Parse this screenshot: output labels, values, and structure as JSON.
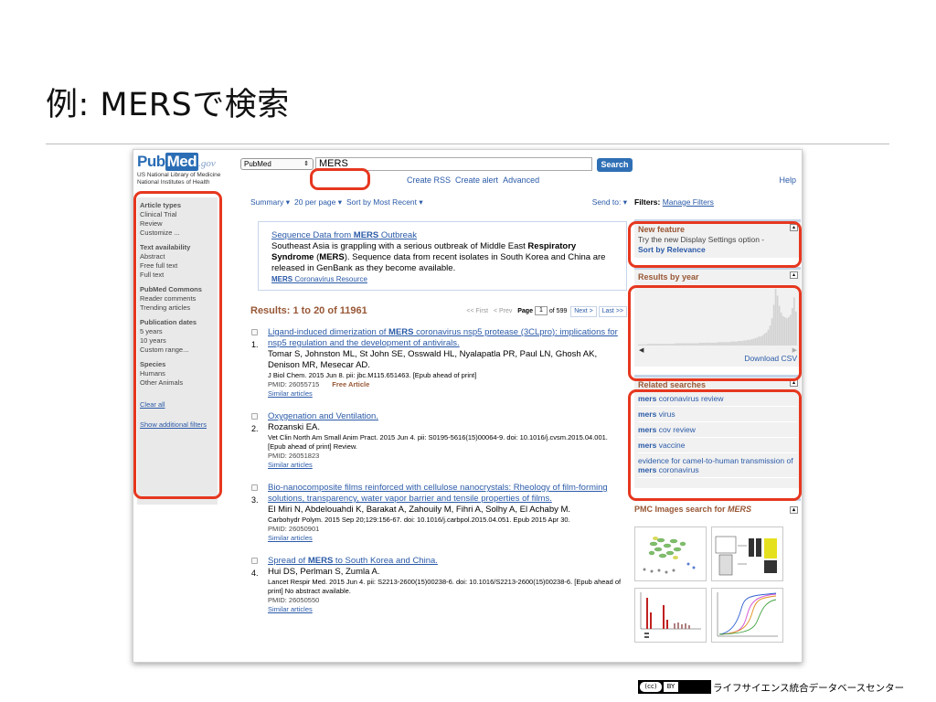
{
  "slide": {
    "title": "例: MERSで検索",
    "footer": "ライフサイエンス統合データベースセンター",
    "license": {
      "cc": "(cc)",
      "by": "BY"
    }
  },
  "pubmed": {
    "logo": {
      "part1": "Pub",
      "part2": "Med",
      "gov": ".gov",
      "sub1": "US National Library of Medicine",
      "sub2": "National Institutes of Health"
    },
    "db_select": "PubMed",
    "search_value": "MERS",
    "search_button": "Search",
    "links": {
      "create_rss": "Create RSS",
      "create_alert": "Create alert",
      "advanced": "Advanced",
      "help": "Help"
    },
    "left_filters": [
      {
        "heading": "Article types",
        "items": [
          "Clinical Trial",
          "Review",
          "Customize ..."
        ]
      },
      {
        "heading": "Text availability",
        "items": [
          "Abstract",
          "Free full text",
          "Full text"
        ]
      },
      {
        "heading": "PubMed Commons",
        "items": [
          "Reader comments",
          "Trending articles"
        ]
      },
      {
        "heading": "Publication dates",
        "items": [
          "5 years",
          "10 years",
          "Custom range..."
        ]
      },
      {
        "heading": "Species",
        "items": [
          "Humans",
          "Other Animals"
        ]
      }
    ],
    "left_links": {
      "clear_all": "Clear all",
      "show_more": "Show additional filters"
    },
    "display_bar": {
      "summary": "Summary ▾",
      "per_page": "20 per page ▾",
      "sort": "Sort by Most Recent ▾",
      "send_to": "Send to: ▾"
    },
    "news": {
      "title_pre": "Sequence Data from ",
      "title_term": "MERS",
      "title_post": " Outbreak",
      "body_1": "Southeast Asia is grappling with a serious outbreak of Middle East ",
      "body_2": "Respiratory Syndrome",
      "body_3": " (",
      "body_4": "MERS",
      "body_5": "). Sequence data from recent isolates in South Korea and China are released in GenBank as they become available.",
      "resource_term": "MERS",
      "resource_post": " Coronavirus Resource"
    },
    "results_count": "Results: 1 to 20 of 11961",
    "pager": {
      "first": "<< First",
      "prev": "< Prev",
      "page_label": "Page",
      "page_value": "1",
      "of": "of 599",
      "next": "Next >",
      "last": "Last >>"
    },
    "results": [
      {
        "num": "1.",
        "title_pre": "Ligand-induced dimerization of ",
        "title_term": "MERS",
        "title_post": " coronavirus nsp5 protease (3CLpro): implications for nsp5 regulation and the development of antivirals.",
        "authors": "Tomar S, Johnston ML, St John SE, Osswald HL, Nyalapatla PR, Paul LN, Ghosh AK, Denison MR, Mesecar AD.",
        "journal": "J Biol Chem. 2015 Jun 8. pii: jbc.M115.651463. [Epub ahead of print]",
        "pmid": "PMID: 26055715",
        "free": "Free Article",
        "similar": "Similar articles"
      },
      {
        "num": "2.",
        "title_pre": "Oxygenation and Ventilation.",
        "title_term": "",
        "title_post": "",
        "authors": "Rozanski EA.",
        "journal": "Vet Clin North Am Small Anim Pract. 2015 Jun 4. pii: S0195-5616(15)00064-9. doi: 10.1016/j.cvsm.2015.04.001. [Epub ahead of print] Review.",
        "pmid": "PMID: 26051823",
        "free": "",
        "similar": "Similar articles"
      },
      {
        "num": "3.",
        "title_pre": "Bio-nanocomposite films reinforced with cellulose nanocrystals: Rheology of film-forming solutions, transparency, water vapor barrier and tensile properties of films.",
        "title_term": "",
        "title_post": "",
        "authors": "El Miri N, Abdelouahdi K, Barakat A, Zahouily M, Fihri A, Solhy A, El Achaby M.",
        "journal": "Carbohydr Polym. 2015 Sep 20;129:156-67. doi: 10.1016/j.carbpol.2015.04.051. Epub 2015 Apr 30.",
        "pmid": "PMID: 26050901",
        "free": "",
        "similar": "Similar articles"
      },
      {
        "num": "4.",
        "title_pre": "Spread of ",
        "title_term": "MERS",
        "title_post": " to South Korea and China.",
        "authors": "Hui DS, Perlman S, Zumla A.",
        "journal": "Lancet Respir Med. 2015 Jun 4. pii: S2213-2600(15)00238-6. doi: 10.1016/S2213-2600(15)00238-6. [Epub ahead of print] No abstract available.",
        "pmid": "PMID: 26050550",
        "free": "",
        "similar": "Similar articles"
      }
    ],
    "right": {
      "filters_label": "Filters:",
      "manage_filters": "Manage Filters",
      "new_feature": {
        "heading": "New feature",
        "line1": "Try the new Display Settings option -",
        "line2": "Sort by Relevance"
      },
      "results_by_year": {
        "heading": "Results by year",
        "download": "Download CSV"
      },
      "related": {
        "heading": "Related searches",
        "items": [
          {
            "bold": "mers",
            "rest": " coronavirus review"
          },
          {
            "bold": "mers",
            "rest": " virus"
          },
          {
            "bold": "mers",
            "rest": " cov review"
          },
          {
            "bold": "mers",
            "rest": " vaccine"
          },
          {
            "bold": "",
            "rest": "evidence for camel-to-human transmission of ",
            "bold2": "mers",
            "rest2": " coronavirus"
          }
        ]
      },
      "pmc": {
        "heading_pre": "PMC Images search for ",
        "heading_term": "MERS"
      }
    }
  },
  "colors": {
    "highlight": "#e6371f",
    "link": "#2a5aa8",
    "brown": "#985735",
    "portlet_bg": "#f1f1f1"
  },
  "chart_data": {
    "type": "bar",
    "title": "Results by year",
    "values": [
      2,
      2,
      2,
      2,
      2,
      3,
      3,
      3,
      3,
      3,
      3,
      3,
      3,
      3,
      3,
      3,
      3,
      3,
      3,
      3,
      4,
      4,
      4,
      4,
      4,
      4,
      4,
      4,
      4,
      4,
      4,
      4,
      4,
      5,
      5,
      5,
      5,
      5,
      5,
      5,
      5,
      5,
      5,
      6,
      6,
      6,
      6,
      6,
      6,
      6,
      7,
      7,
      7,
      7,
      8,
      8,
      8,
      9,
      9,
      10,
      10,
      11,
      12,
      13,
      14,
      16,
      16,
      18,
      21,
      23,
      28,
      35,
      48,
      72,
      100,
      88,
      70,
      58,
      52,
      50,
      48,
      50,
      54,
      66,
      85,
      60
    ],
    "ylim": [
      0,
      100
    ]
  }
}
